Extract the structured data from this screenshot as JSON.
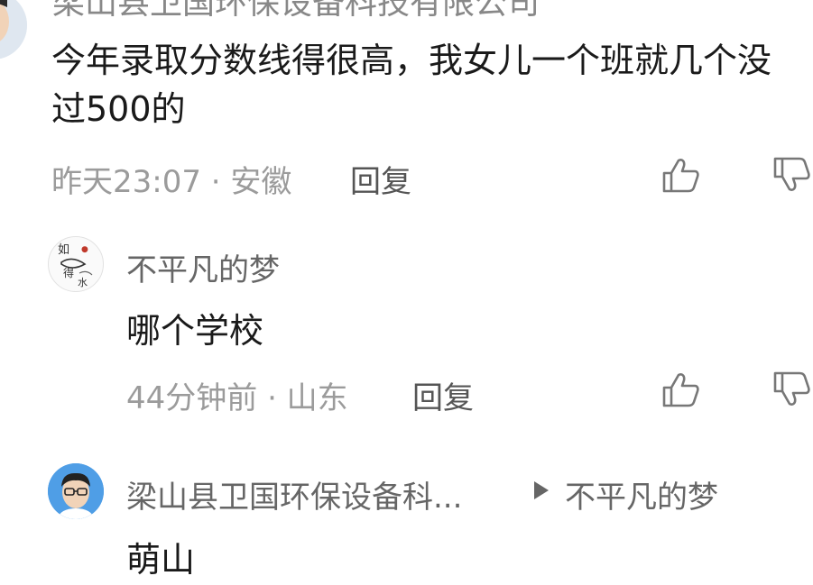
{
  "top_comment": {
    "author": "梁山县卫国环保设备科技有限公司",
    "text": "今年录取分数线得很高，我女儿一个班就几个没过500的",
    "time_location": "昨天23:07 · 安徽",
    "reply_label": "回复"
  },
  "replies": [
    {
      "author": "不平凡的梦",
      "text": "哪个学校",
      "time_location": "44分钟前 · 山东",
      "reply_label": "回复",
      "avatar_text": "如 鱼 得 水"
    },
    {
      "author": "梁山县卫国环保设备科...",
      "reply_to": "不平凡的梦",
      "text": "萌山"
    }
  ],
  "icons": {
    "like": "thumbs-up-icon",
    "dislike": "thumbs-down-icon",
    "reply_arrow": "triangle-right-icon"
  }
}
